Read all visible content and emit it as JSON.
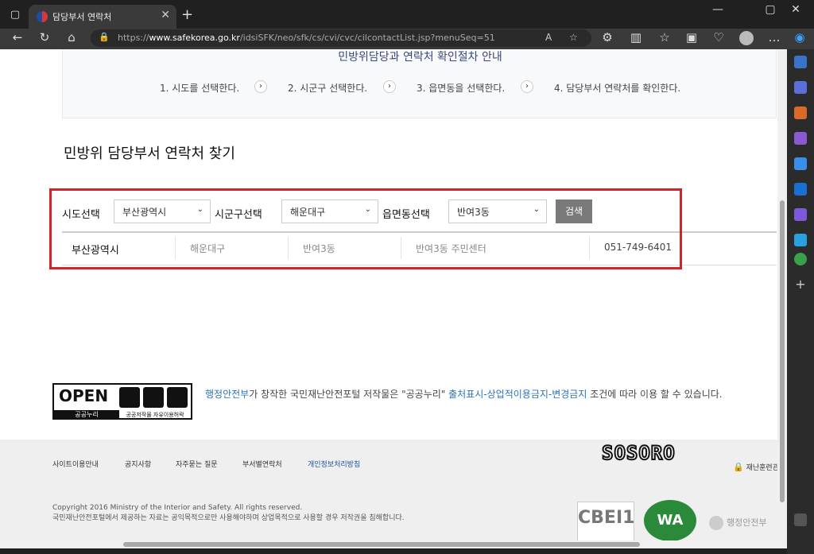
{
  "browser": {
    "tab_title": "담당부서 연락처",
    "tab_close": "✕",
    "new_tab": "+",
    "url_prefix": "https://",
    "url_domain": "www.safekorea.go.kr",
    "url_path": "/idsiSFK/neo/sfk/cs/cvi/cvc/cilcontactList.jsp?menuSeq=51",
    "read_aloud": "A",
    "icons": [
      "tab-actions-icon",
      "back-icon",
      "refresh-icon",
      "home-icon",
      "lock-icon",
      "read-aloud-icon",
      "favorite-icon",
      "extensions-icon",
      "split-screen-icon",
      "favorites-icon",
      "collections-icon",
      "performance-icon",
      "profile-icon",
      "more-icon",
      "copilot-icon"
    ]
  },
  "procedure": {
    "title": "민방위담당과 연락처 확인절차 안내",
    "steps": [
      "1. 시도를 선택한다.",
      "2. 시군구 선택한다.",
      "3. 읍면동을 선택한다.",
      "4. 담당부서 연락처를 확인한다."
    ],
    "arrow": "›"
  },
  "section": {
    "title": "민방위 담당부서 연락처 찾기"
  },
  "search": {
    "sido_label": "시도선택",
    "sido_value": "부산광역시",
    "sigungu_label": "시군구선택",
    "sigungu_value": "해운대구",
    "emd_label": "읍면동선택",
    "emd_value": "반여3동",
    "button": "검색",
    "caret": "⌄"
  },
  "result": {
    "cells": [
      "부산광역시",
      "해운대구",
      "반여3동",
      "반여3동 주민센터",
      "051-749-6401"
    ]
  },
  "license": {
    "open_text": "OPEN",
    "open_sub": "공공누리",
    "open_sub2": "공공저작물 자유이용허락",
    "org_link": "행정안전부",
    "text1": "가 창작한 국민재난안전포털 저작물은 \"공공누리\" ",
    "terms_link": "출처표시-상업적이용금지-변경금지",
    "text2": " 조건에 따라 이용 할 수 있습니다."
  },
  "footer": {
    "nav": [
      "사이트이용안내",
      "공지사항",
      "자주묻는 질문",
      "부서별연락처",
      "개인정보처리방침"
    ],
    "watermark": "SOSORO",
    "training": "재난훈련관",
    "copyright_line1": "Copyright 2016 Ministry of the Interior and Safety. All rights reserved.",
    "copyright_line2": "국민재난안전포털에서 제공하는 자료는 공익목적으로만 사용해야하며 상업목적으로 사용할 경우 저작권을 침해합니다.",
    "cbei": "CBEI1",
    "wa": "WA",
    "ministry": "행정안전부"
  },
  "colors": {
    "highlight_border": "#d1232a",
    "link": "#2b73b8",
    "button": "#7a7a7a"
  }
}
